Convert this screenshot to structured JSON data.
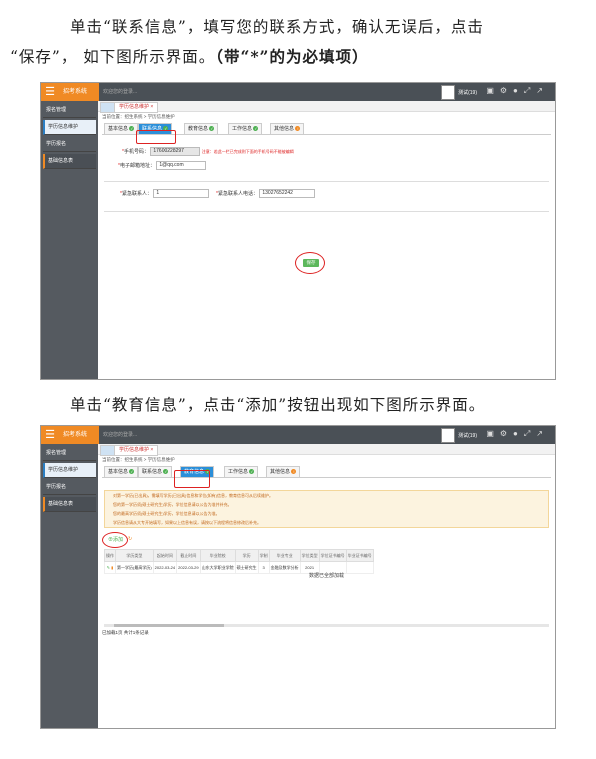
{
  "instructions": {
    "p1_line1": "单击“联系信息”，填写您的联系方式，确认无误后，点击",
    "p1_line2_plain": "“保存”， 如下图所示界面。",
    "p1_line2_bold": "（带“*”的为必填项）",
    "p2": "单击“教育信息”，点击“添加”按钮出现如下图所示界面。"
  },
  "app": {
    "brand": "招考系统",
    "search_hint": "欢迎您的登录...",
    "user": "测试(19)",
    "sidebar": [
      "报名管理",
      "学历信息维护",
      "学历报名",
      "基础信息表"
    ],
    "page_tab": "学历信息维护",
    "breadcrumb": "当前位置：招生系统 > 学历信息维护",
    "subtabs": [
      "基本信息",
      "联系信息",
      "教育信息",
      "工作信息",
      "其他信息"
    ]
  },
  "contact_form": {
    "phone_label": "手机号码：",
    "phone_value": "17600228297",
    "phone_note": "注意：若此一栏已完成则下面的手机号码不能被编辑",
    "email_label": "电子邮箱地址：",
    "email_value": "1@qq.com",
    "emergency_label": "紧急联系人：",
    "emergency_value": "1",
    "emergency_phone_label": "紧急联系人电话：",
    "emergency_phone_value": "13027652242",
    "save": "保存"
  },
  "education": {
    "notices": [
      "对第一学历(已出具)，需填写学历(已出具)信息和学位(如有)信息，教育信息可从后续维护。",
      "您的第一学历须(硕士研究生)学历，学位信息请以公告为准并补充。",
      "您的最高学历须(硕士研究生)学历，学位信息请以公告为准。",
      "学历信息请从大专开始填写，如果以上信息有误，请按以下流程将信息修改后补充。"
    ],
    "add": "添加",
    "columns": [
      "操作",
      "学历类型",
      "起始时间",
      "截止时间",
      "毕业院校",
      "学历",
      "学制",
      "毕业专业",
      "学位类型",
      "学位证书编号",
      "毕业证书编号"
    ],
    "row": [
      "",
      "第一学历(最高学历)",
      "2022-03-24",
      "2022-03-29",
      "山东大学职业学院",
      "硕士研究生",
      "3",
      "金融及数学分析",
      "2021",
      "",
      ""
    ],
    "end_note": "数据已全部加载",
    "footer": "已加载1页 共计1条记录"
  }
}
